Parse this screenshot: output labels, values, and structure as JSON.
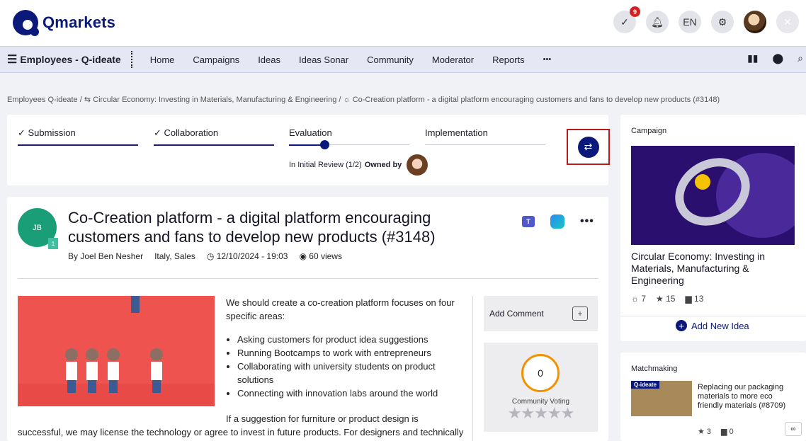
{
  "brand": {
    "name": "Qmarkets"
  },
  "top": {
    "notifications_count": "9",
    "language": "EN"
  },
  "nav": {
    "brand_title": "Employees - Q-ideate",
    "items": [
      "Home",
      "Campaigns",
      "Ideas",
      "Ideas Sonar",
      "Community",
      "Moderator",
      "Reports"
    ],
    "more": "•••"
  },
  "breadcrumb": {
    "root": "Employees Q-ideate",
    "campaign": "Circular Economy: Investing in Materials, Manufacturing & Engineering",
    "idea": "Co-Creation platform - a digital platform encouraging customers and fans to develop new products (#3148)"
  },
  "stages": {
    "submission": "Submission",
    "collaboration": "Collaboration",
    "evaluation": "Evaluation",
    "implementation": "Implementation",
    "status": "In Initial Review (1/2)",
    "owned_by": "Owned by"
  },
  "idea": {
    "author_initials": "JB",
    "author_badge": "1",
    "title": "Co-Creation platform - a digital platform encouraging customers and fans to develop new products (#3148)",
    "by_label": "By",
    "author": "Joel Ben Nesher",
    "location": "Italy, Sales",
    "datetime": "12/10/2024 - 19:03",
    "views": "60 views",
    "intro": "We should create a co-creation platform focuses on four specific areas:",
    "bullets": [
      "Asking customers for product idea suggestions",
      "Running Bootcamps to work with entrepreneurs",
      "Collaborating with university students on product solutions",
      "Connecting with innovation labs around the world"
    ],
    "tail_line1": "If a suggestion for furniture or product design is",
    "tail_line2": "successful, we may license the technology or agree to invest in future products. For designers and technically"
  },
  "actions": {
    "add_comment": "Add Comment",
    "vote_count": "0",
    "vote_label": "Community Voting",
    "stars": "★★★★★"
  },
  "campaign": {
    "section_label": "Campaign",
    "title": "Circular Economy: Investing in Materials, Manufacturing & Engineering",
    "ideas_count": "7",
    "stars_count": "15",
    "comments_count": "13",
    "add_idea": "Add New Idea"
  },
  "matchmaking": {
    "section_label": "Matchmaking",
    "tag": "Q-ideate",
    "title": "Replacing our packaging materials to more eco friendly materials (#8709)",
    "stars_count": "3",
    "comments_count": "0"
  },
  "colors": {
    "brand_navy": "#0b1a7a",
    "highlight_border": "#b71c1c",
    "vote_ring": "#f39200",
    "avatar_green": "#1a9e78"
  }
}
